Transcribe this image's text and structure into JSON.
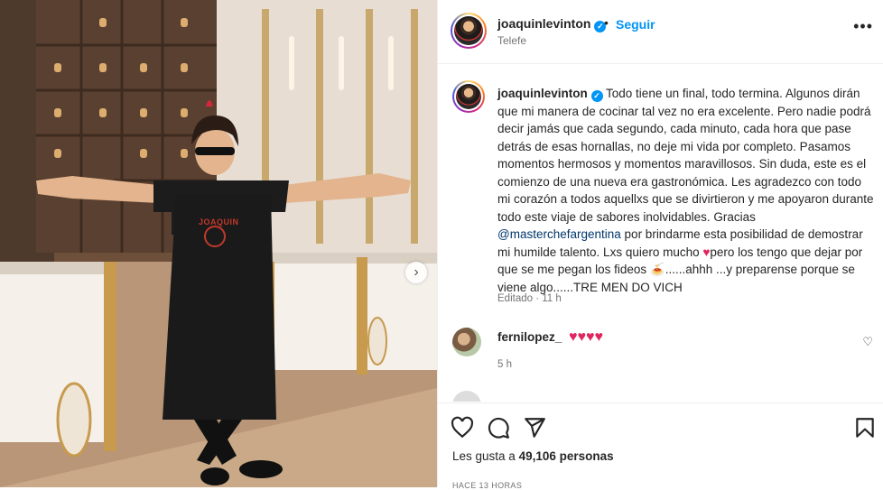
{
  "header": {
    "username": "joaquinlevinton",
    "separator": "•",
    "follow_label": "Seguir",
    "location": "Telefe",
    "more_icon": "more-icon"
  },
  "caption": {
    "username": "joaquinlevinton",
    "text_part1": "Todo tiene un final, todo termina. Algunos dirán que mi manera de cocinar tal vez no era excelente. Pero nadie podrá decir jamás que cada segundo, cada minuto, cada hora que pase detrás de esas hornallas, no deje mi vida por completo. Pasamos momentos hermosos y momentos maravillosos. Sin duda, este es el comienzo de una nueva era gastronómica. Les agradezco con todo mi corazón a todos aquellxs que se divirtieron y me apoyaron durante todo este viaje de sabores inolvidables. Gracias",
    "mention": "@masterchefargentina",
    "text_part2": "por brindarme esta posibilidad de demostrar mi humilde talento. Lxs quiero mucho",
    "heart": "♥",
    "text_part3": "pero los tengo que dejar por que se me pegan los fideos",
    "bowl": "🍝",
    "text_part4": "......ahhh ...y preparense porque se viene algo......TRE MEN DO VICH",
    "meta": "Editado · 11 h"
  },
  "comments": [
    {
      "username": "fernilopez_",
      "hearts": "♥♥♥♥",
      "meta": "5 h"
    }
  ],
  "actions": {
    "likes_prefix": "Les gusta a",
    "likes_count": "49,106 personas",
    "time_ago": "HACE 13 HORAS"
  },
  "photo": {
    "apron_text": "JOAQUIN",
    "next_icon": "chevron-right-icon"
  },
  "colors": {
    "accent": "#0095f6",
    "mention": "#00376b",
    "heart": "#e0245e"
  }
}
